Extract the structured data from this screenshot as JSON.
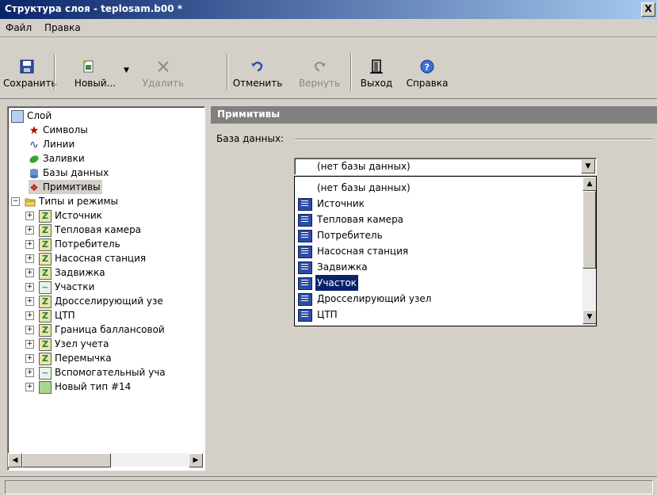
{
  "window": {
    "title": "Структура слоя - teplosam.b00 *",
    "close_glyph": "X"
  },
  "menu": [
    {
      "label": "Файл"
    },
    {
      "label": "Правка"
    }
  ],
  "toolbar": [
    {
      "label": "Сохранить",
      "icon": "save-icon",
      "enabled": true
    },
    {
      "label": "Новый...",
      "icon": "new-icon",
      "enabled": true
    },
    {
      "label": "Удалить",
      "icon": "delete-icon",
      "enabled": false
    },
    {
      "label": "Отменить",
      "icon": "undo-icon",
      "enabled": true
    },
    {
      "label": "Вернуть",
      "icon": "redo-icon",
      "enabled": false
    },
    {
      "label": "Выход",
      "icon": "exit-icon",
      "enabled": true
    },
    {
      "label": "Справка",
      "icon": "help-icon",
      "enabled": true
    }
  ],
  "tree": {
    "root": "Слой",
    "layer_items": [
      "Символы",
      "Линии",
      "Заливки",
      "Базы данных",
      "Примитивы"
    ],
    "types_root": "Типы и режимы",
    "types": [
      "Источник",
      "Тепловая камера",
      "Потребитель",
      "Насосная станция",
      "Задвижка",
      "Участки",
      "Дросселирующий узе",
      "ЦТП",
      "Граница баллансовой",
      "Узел учета",
      "Перемычка",
      "Вспомогательный уча",
      "Новый тип #14"
    ]
  },
  "panel": {
    "title": "Примитивы",
    "db_label": "База данных:",
    "combo_value": "(нет базы данных)",
    "options": [
      "(нет базы данных)",
      "Источник",
      "Тепловая камера",
      "Потребитель",
      "Насосная станция",
      "Задвижка",
      "Участок",
      "Дросселирующий узел",
      "ЦТП"
    ],
    "selected_option": "Участок"
  },
  "colors": {
    "title_start": "#0a246a",
    "title_end": "#a6caf0",
    "selection": "#0a246a",
    "panel_header": "#808080"
  }
}
